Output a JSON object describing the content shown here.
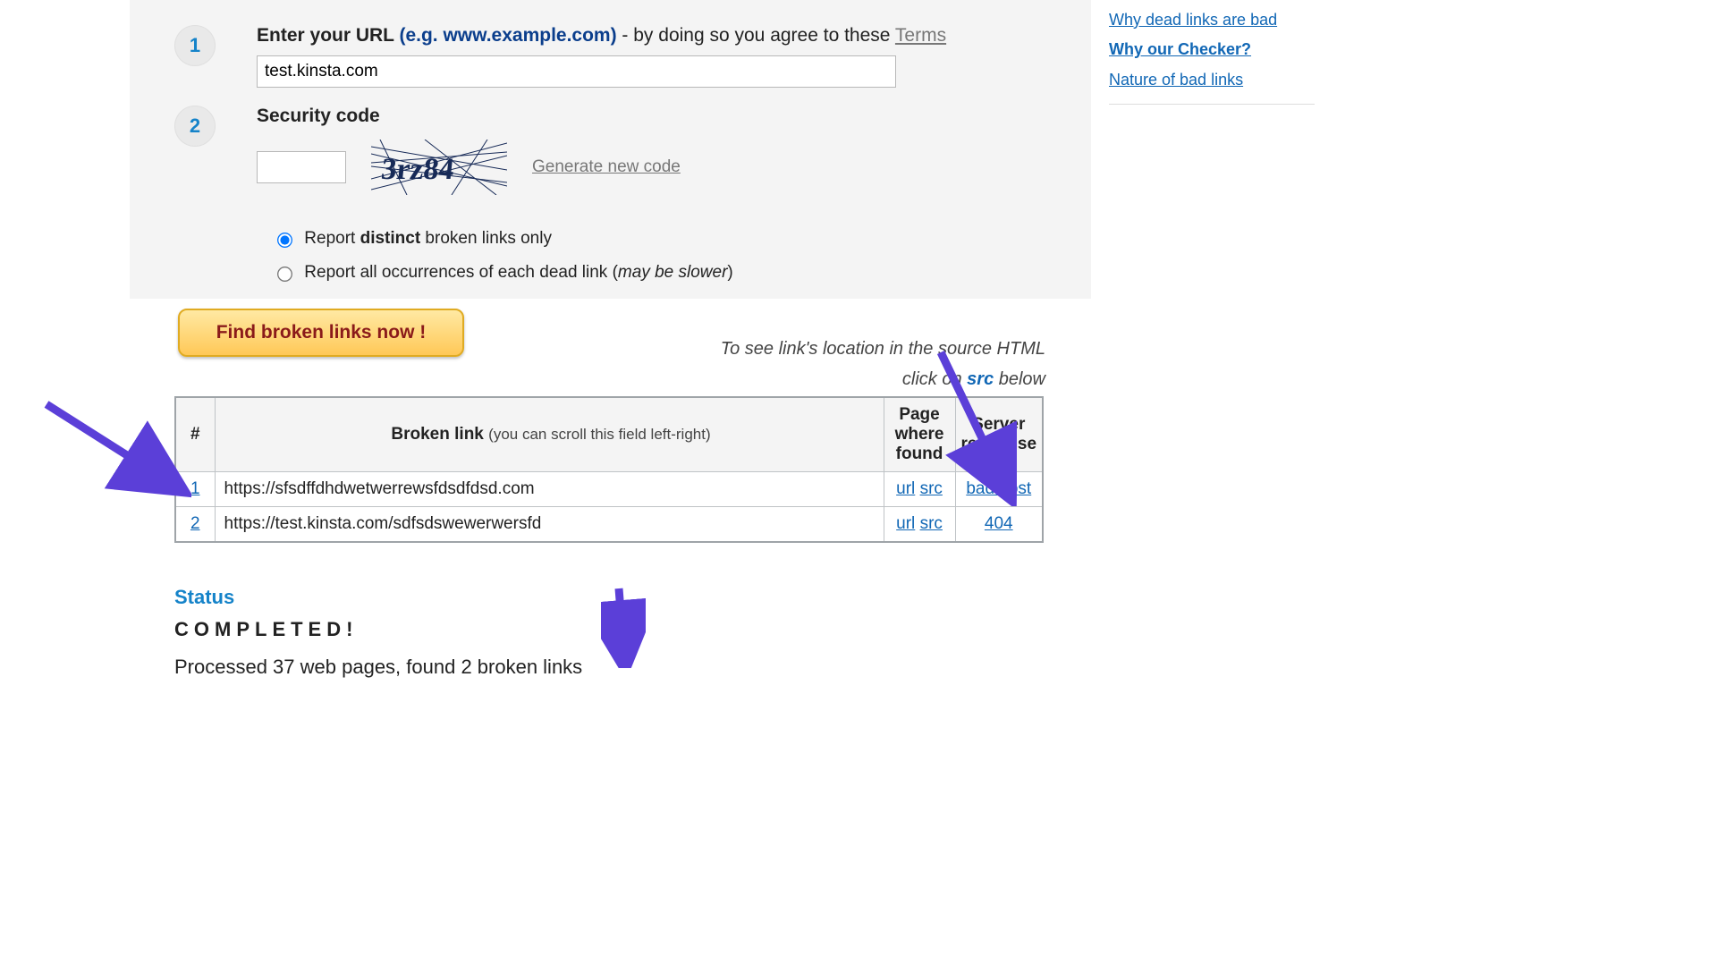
{
  "step1": {
    "number": "1",
    "label_prefix": "Enter your URL ",
    "label_example": "(e.g. www.example.com)",
    "label_suffix": " - by doing so you agree to these ",
    "terms_link": "Terms",
    "url_value": "test.kinsta.com"
  },
  "step2": {
    "number": "2",
    "label": "Security code",
    "captcha_text": "3rz84",
    "generate_link": "Generate new code",
    "radio_distinct_pre": "Report ",
    "radio_distinct_bold": "distinct",
    "radio_distinct_post": " broken links only",
    "radio_all_pre": "Report all occurrences of each dead link (",
    "radio_all_italic": "may be slower",
    "radio_all_post": ")"
  },
  "actions": {
    "find_button": "Find broken links now !"
  },
  "hint": {
    "line1": "To see link's location in the source HTML",
    "line2_pre": "click on ",
    "line2_src": "src",
    "line2_post": " below"
  },
  "table": {
    "col_num": "#",
    "col_link_main": "Broken link",
    "col_link_sub": "(you can scroll this field left-right)",
    "col_pwf": "Page where found",
    "col_resp": "Server response",
    "rows": [
      {
        "n": "1",
        "link": "https://sfsdffdhdwetwerrewsfdsdfdsd.com",
        "url": "url",
        "src": "src",
        "resp": "bad host"
      },
      {
        "n": "2",
        "link": "https://test.kinsta.com/sdfsdswewerwersfd",
        "url": "url",
        "src": "src",
        "resp": "404"
      }
    ]
  },
  "status": {
    "title": "Status",
    "completed": "COMPLETED!",
    "summary": "Processed 37 web pages, found 2 broken links"
  },
  "sidebar": {
    "links": [
      {
        "label": "Why dead links are bad",
        "active": false
      },
      {
        "label": "Why our Checker?",
        "active": true
      },
      {
        "label": "Nature of bad links",
        "active": false
      }
    ]
  },
  "colors": {
    "arrow_fill": "#5b3fd8"
  }
}
